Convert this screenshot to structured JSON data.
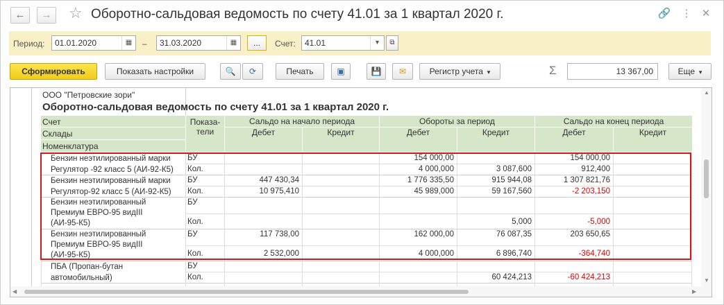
{
  "window": {
    "title": "Оборотно-сальдовая ведомость по счету 41.01 за 1 квартал 2020 г."
  },
  "period": {
    "label": "Период:",
    "from": "01.01.2020",
    "dash": "–",
    "to": "31.03.2020",
    "more": "...",
    "account_label": "Счет:",
    "account": "41.01"
  },
  "toolbar": {
    "generate": "Сформировать",
    "settings": "Показать настройки",
    "print": "Печать",
    "register": "Регистр учета",
    "sum_sign": "Σ",
    "sum_value": "13 367,00",
    "more": "Еще"
  },
  "report": {
    "org": "ООО \"Петровские зори\"",
    "title": "Оборотно-сальдовая ведомость по счету 41.01 за 1 квартал 2020 г.",
    "headers": {
      "account": "Счет",
      "warehouses": "Склады",
      "nomenclature": "Номенклатура",
      "indicators": "Показа-\nтели",
      "opening": "Сальдо на начало периода",
      "turnover": "Обороты за период",
      "closing": "Сальдо на конец периода",
      "debit": "Дебет",
      "credit": "Кредит"
    },
    "rows": [
      {
        "name": "Бензин неэтилированный марки\nРегулятор -92 класс 5 (АИ-92-К5)",
        "bu": [
          "",
          "",
          "154 000,00",
          "",
          "154 000,00",
          ""
        ],
        "kol": [
          "",
          "",
          "4 000,000",
          "3 087,600",
          "912,400",
          ""
        ]
      },
      {
        "name": "Бензин неэтилированный марки\nРегулятор-92 класс 5 (АИ-92-К5)",
        "bu": [
          "447 430,34",
          "",
          "1 776 335,50",
          "915 944,08",
          "1 307 821,76",
          ""
        ],
        "kol": [
          "10 975,410",
          "",
          "45 989,000",
          "59 167,560",
          "-2 203,150",
          ""
        ]
      },
      {
        "name": "Бензин неэтилированный\nПремиум ЕВРО-95 видIII\n(АИ-95-К5)",
        "bu": [
          "",
          "",
          "",
          "",
          "",
          ""
        ],
        "kol": [
          "",
          "",
          "",
          "5,000",
          "-5,000",
          ""
        ]
      },
      {
        "name": "Бензин неэтилированный\nПремиум ЕВРО-95 видIII\n(АИ-95-К5)",
        "bu": [
          "117 738,00",
          "",
          "162 000,00",
          "76 087,35",
          "203 650,65",
          ""
        ],
        "kol": [
          "2 532,000",
          "",
          "4 000,000",
          "6 896,740",
          "-364,740",
          ""
        ]
      },
      {
        "name": "ПБА (Пропан-бутан\nавтомобильный)",
        "bu": [
          "",
          "",
          "",
          "",
          "",
          ""
        ],
        "kol": [
          "",
          "",
          "",
          "60 424,213",
          "-60 424,213",
          ""
        ]
      }
    ],
    "indicator_bu": "БУ",
    "indicator_kol": "Кол."
  }
}
